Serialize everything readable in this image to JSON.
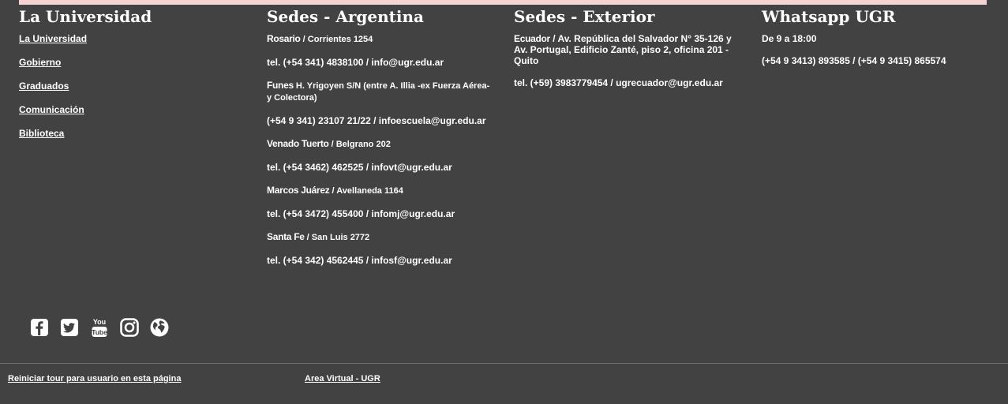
{
  "col_universidad": {
    "title": "La Universidad",
    "links": [
      "La Universidad",
      "Gobierno",
      "Graduados",
      "Comunicación",
      "Biblioteca"
    ]
  },
  "col_argentina": {
    "title": "Sedes - Argentina",
    "rosario": {
      "city": "Rosario",
      "addr": " / Corrientes 1254",
      "contact": "tel. (+54 341) 4838100 / info@ugr.edu.ar"
    },
    "funes": {
      "city": "Funes",
      "addr": " H. Yrigoyen S/N (entre A. Illia -ex Fuerza Aérea- y Colectora)",
      "contact": "(+54 9 341) 23107 21/22 / infoescuela@ugr.edu.ar"
    },
    "venado": {
      "city": "Venado Tuerto",
      "addr": " / Belgrano 202",
      "contact": "tel. (+54 3462) 462525 / infovt@ugr.edu.ar"
    },
    "marcos": {
      "city": "Marcos Juárez",
      "addr": " / Avellaneda 1164",
      "contact": "tel. (+54 3472) 455400 / infomj@ugr.edu.ar"
    },
    "santafe": {
      "city": "Santa Fe",
      "addr": " / San Luis 2772",
      "contact": "tel. (+54 342) 4562445 / infosf@ugr.edu.ar"
    }
  },
  "col_exterior": {
    "title": "Sedes - Exterior",
    "ecuador": {
      "city": "Ecuador",
      "addr": " / Av. República del Salvador N° 35-126 y Av. Portugal, Edificio Zanté, piso 2, oficina 201 - Quito",
      "contact": "tel. (+59) 3983779454 / ugrecuador@ugr.edu.ar"
    }
  },
  "col_whatsapp": {
    "title": "Whatsapp UGR",
    "hours": "De 9 a 18:00",
    "numbers": "(+54 9 3413) 893585 / (+54 9 3415) 865574"
  },
  "social": {
    "icons": [
      "facebook-icon",
      "twitter-icon",
      "youtube-icon",
      "instagram-icon",
      "globe-icon"
    ],
    "youtube_top": "You",
    "youtube_bottom": "Tube"
  },
  "bottom": {
    "tour_link": "Reiniciar tour para usuario en esta página",
    "virtual_link": "Area Virtual - UGR"
  },
  "colors": {
    "background": "#424242",
    "top_strip": "#f6d3d3",
    "text": "#ffffff",
    "divider": "#6e6e6e"
  }
}
